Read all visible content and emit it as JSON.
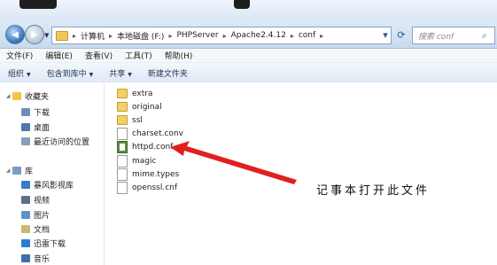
{
  "address": {
    "crumbs": [
      "计算机",
      "本地磁盘 (F:)",
      "PHPServer",
      "Apache2.4.12",
      "conf"
    ],
    "separator": "▸"
  },
  "search": {
    "placeholder": "搜索 conf"
  },
  "menu": [
    "文件(F)",
    "编辑(E)",
    "查看(V)",
    "工具(T)",
    "帮助(H)"
  ],
  "commands": [
    {
      "label": "组织",
      "dropdown": true
    },
    {
      "label": "包含到库中",
      "dropdown": true
    },
    {
      "label": "共享",
      "dropdown": true
    },
    {
      "label": "新建文件夹",
      "dropdown": false
    }
  ],
  "sidebar": {
    "favorites_label": "收藏夹",
    "favorites": [
      "下载",
      "桌面",
      "最近访问的位置"
    ],
    "library_label": "库",
    "libraries": [
      "暴风影视库",
      "视频",
      "图片",
      "文档",
      "迅雷下载",
      "音乐"
    ]
  },
  "files": [
    {
      "name": "extra",
      "type": "folder"
    },
    {
      "name": "original",
      "type": "folder"
    },
    {
      "name": "ssl",
      "type": "folder"
    },
    {
      "name": "charset.conv",
      "type": "file"
    },
    {
      "name": "httpd.conf",
      "type": "notepad"
    },
    {
      "name": "magic",
      "type": "file"
    },
    {
      "name": "mime.types",
      "type": "file"
    },
    {
      "name": "openssl.cnf",
      "type": "file"
    }
  ],
  "annotation": "记事本打开此文件",
  "colors": {
    "arrow": "#e02020",
    "accent": "#2f6fb6"
  },
  "icons": {
    "back": "back-arrow-icon",
    "forward": "forward-arrow-icon",
    "refresh": "refresh-icon",
    "search": "search-icon"
  }
}
